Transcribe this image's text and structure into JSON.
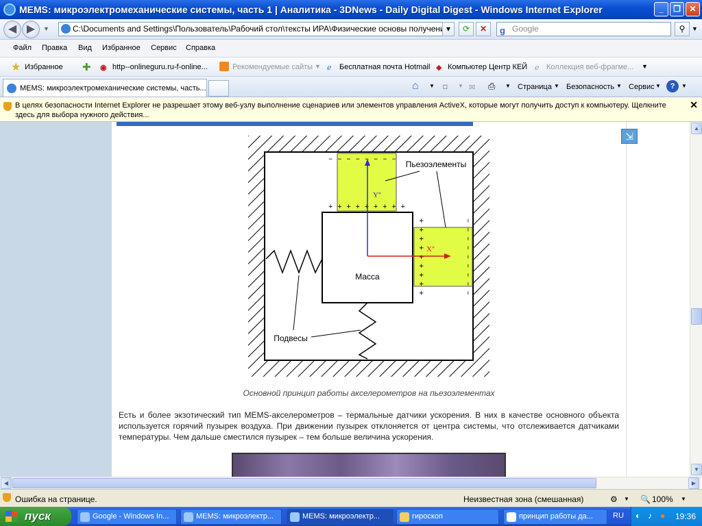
{
  "window": {
    "title": "MEMS: микроэлектромеханические системы, часть 1 | Аналитика - 3DNews - Daily Digital Digest - Windows Internet Explorer"
  },
  "address": {
    "url": "C:\\Documents and Settings\\Пользователь\\Рабочий стол\\тексты ИРА\\Физические основы получения инфор",
    "search_placeholder": "Google"
  },
  "menu": [
    "Файл",
    "Правка",
    "Вид",
    "Избранное",
    "Сервис",
    "Справка"
  ],
  "favorites": {
    "label": "Избранное",
    "items": [
      "http--onlineguru.ru-f-online...",
      "Рекомендуемые сайты",
      "Бесплатная почта Hotmail",
      "Компьютер Центр КЕЙ",
      "Коллекция веб-фрагме..."
    ]
  },
  "tab": {
    "title": "MEMS: микроэлектромеханические системы, часть..."
  },
  "commandbar": {
    "page": "Страница",
    "safety": "Безопасность",
    "tools": "Сервис"
  },
  "infobar": {
    "text": "В целях безопасности Internet Explorer не разрешает этому веб-узлу выполнение сценариев или элементов управления ActiveX, которые могут получить доступ к компьютеру. Щелкните здесь для выбора нужного действия..."
  },
  "diagram": {
    "piezo_label": "Пьезоэлементы",
    "mass_label": "Масса",
    "springs_label": "Подвесы",
    "y_axis": "Y''",
    "x_axis": "X''",
    "plus_row": "+ + + + + + + + +",
    "minus_row": "– – – – – – – – –"
  },
  "article": {
    "caption": "Основной принцип работы акселерометров на пьезоэлементах",
    "paragraph": "Есть и более экзотический тип MEMS-акселерометров – термальные датчики ускорения. В них в качестве основного объекта используется горячий пузырек воздуха. При движении пузырек отклоняется от центра системы, что отслеживается датчиками температуры. Чем дальше сместился пузырек – тем больше величина ускорения."
  },
  "status": {
    "error": "Ошибка на странице.",
    "zone": "Неизвестная зона (смешанная)",
    "zoom": "100%"
  },
  "taskbar": {
    "start": "пуск",
    "tasks": [
      "Google - Windows In...",
      "MEMS: микроэлектр...",
      "MEMS: микроэлектр...",
      "гироскоп",
      "принцип работы да..."
    ],
    "lang": "RU",
    "time": "19:36"
  }
}
